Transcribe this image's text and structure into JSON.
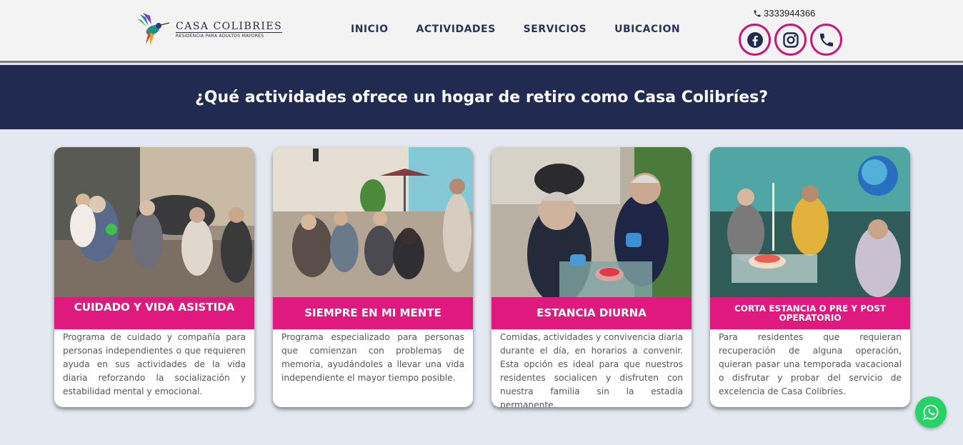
{
  "header": {
    "logo_title": "CASA COLIBRIES",
    "logo_subtitle": "RESIDENCIA PARA ADULTOS MAYORES",
    "nav": [
      "INICIO",
      "ACTIVIDADES",
      "SERVICIOS",
      "UBICACION"
    ],
    "phone": "3333944366",
    "social_icons": [
      "facebook-icon",
      "instagram-icon",
      "phone-icon"
    ]
  },
  "banner": {
    "title": "¿Qué actividades ofrece un hogar de retiro como Casa Colibríes?"
  },
  "cards": [
    {
      "title": "CUIDADO Y VIDA ASISTIDA",
      "description": "Programa de cuidado y compañía para personas independientes o que requieren ayuda en sus actividades de la vida diaria reforzando la socialización y estabilidad mental y emocional."
    },
    {
      "title": "SIEMPRE EN MI MENTE",
      "description": "Programa especializado para personas que comienzan con problemas de memoria, ayudándoles a llevar una vida independiente el mayor tiempo posible."
    },
    {
      "title": "ESTANCIA DIURNA",
      "description": "Comidas, actividades y convivencia diaria durante el día, en horarios a convenir. Esta opción es ideal para que nuestros residentes socialicen y disfruten con nuestra familia sin la estadía permanente."
    },
    {
      "title": "CORTA ESTANCIA O PRE Y POST OPERATORIO",
      "description": "Para residentes que requieran recuperación de alguna operación, quieran pasar una temporada vacacional o disfrutar y probar del servicio de excelencia de Casa Colibríes."
    }
  ],
  "colors": {
    "navy": "#212a50",
    "magenta": "#e0197f",
    "social_border": "#c8177b",
    "whatsapp": "#25d366"
  }
}
